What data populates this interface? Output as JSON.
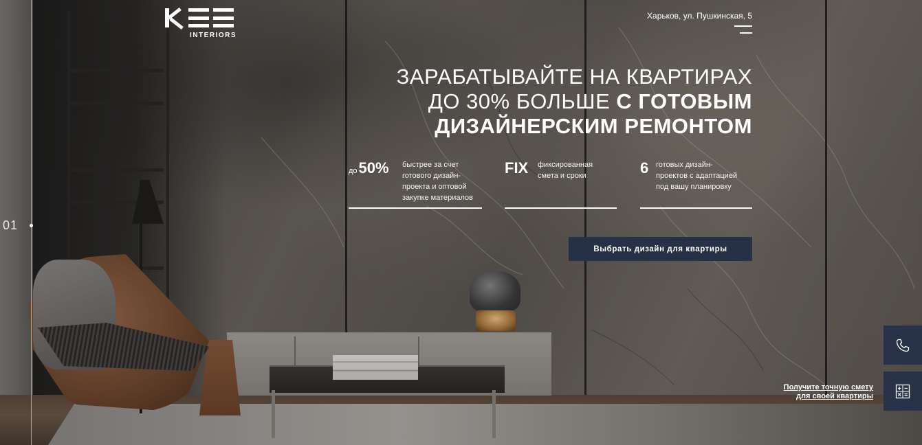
{
  "brand": {
    "mark": "KEE",
    "subtitle": "INTERIORS"
  },
  "header": {
    "address": "Харьков, ул. Пушкинская, 5"
  },
  "slider": {
    "current": "01"
  },
  "hero": {
    "title_line1": "ЗАРАБАТЫВАЙТЕ НА КВАРТИРАХ",
    "title_line2_light": "ДО 30% БОЛЬШЕ ",
    "title_line2_bold": "С ГОТОВЫМ",
    "title_line3_bold": "ДИЗАЙНЕРСКИМ РЕМОНТОМ"
  },
  "stats": [
    {
      "prefix": "до",
      "value": "50%",
      "text": [
        "быстрее за счет",
        "готового дизайн-",
        "проекта и оптовой",
        "закупке материалов"
      ]
    },
    {
      "prefix": "",
      "value": "FIX",
      "text": [
        "фиксированная",
        "смета и сроки"
      ]
    },
    {
      "prefix": "",
      "value": "6",
      "text": [
        "готовых дизайн-",
        "проектов с адаптацией",
        "под вашу планировку"
      ]
    }
  ],
  "cta": {
    "label": "Выбрать дизайн для квартиры"
  },
  "estimate_link": {
    "line1": "Получите точную смету",
    "line2": "для своей квартиры"
  },
  "widgets": {
    "phone_icon": "phone-icon",
    "calculator_icon": "calculator-icon",
    "accent": "#283349"
  }
}
